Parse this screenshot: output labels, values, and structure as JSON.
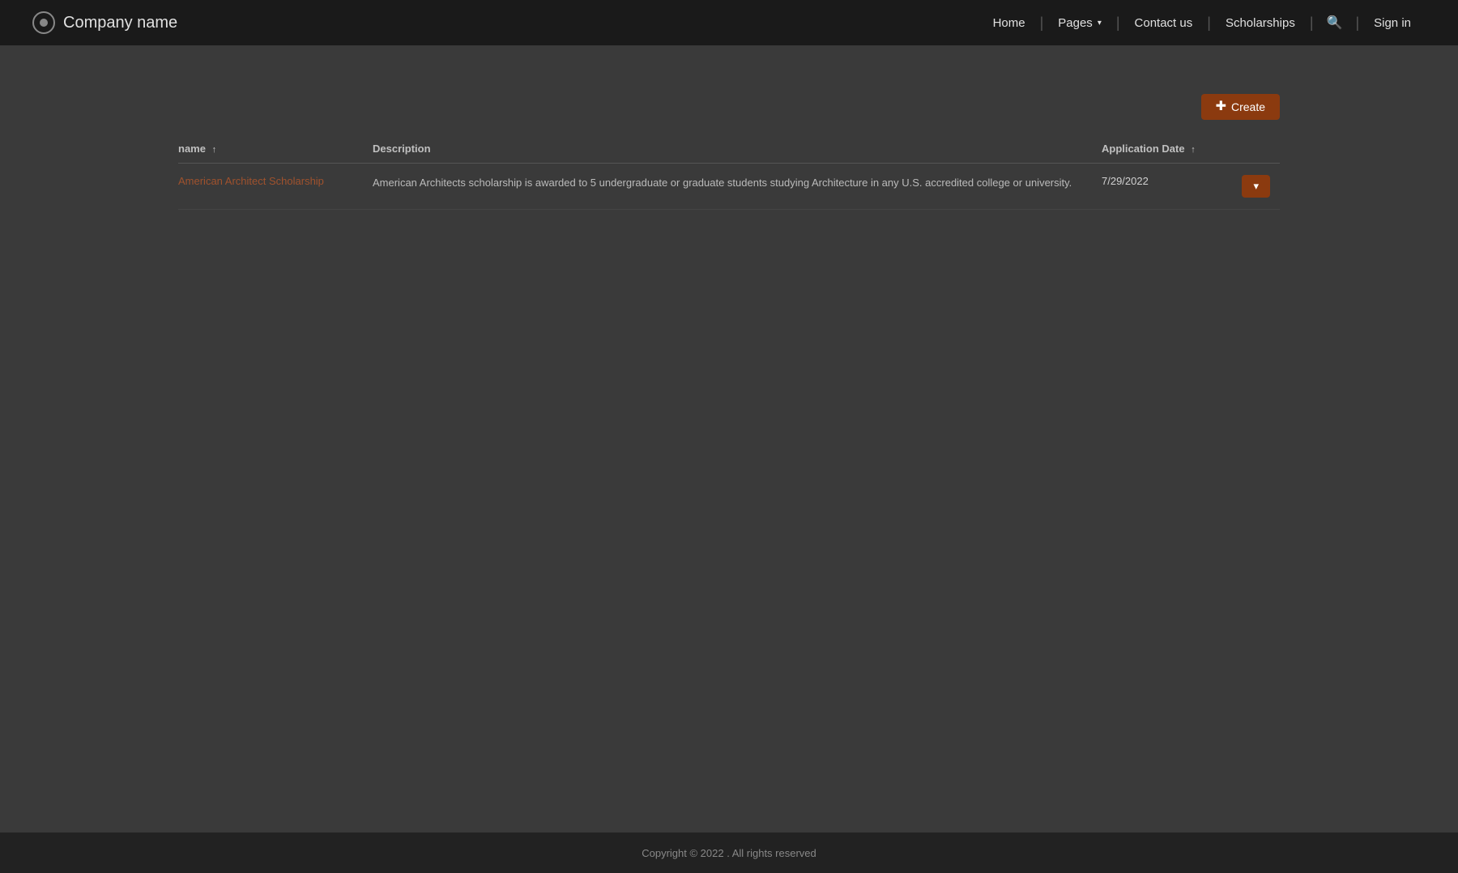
{
  "brand": {
    "name": "Company name"
  },
  "navbar": {
    "home_label": "Home",
    "pages_label": "Pages",
    "contact_label": "Contact us",
    "scholarships_label": "Scholarships",
    "signin_label": "Sign in"
  },
  "toolbar": {
    "create_label": "Create"
  },
  "table": {
    "col_name": "name",
    "col_description": "Description",
    "col_date": "Application Date",
    "rows": [
      {
        "name": "American Architect Scholarship",
        "description": "American Architects scholarship is awarded to 5 undergraduate or graduate students studying Architecture in any U.S. accredited college or university.",
        "application_date": "7/29/2022"
      }
    ]
  },
  "footer": {
    "copyright": "Copyright © 2022 . All rights reserved"
  }
}
